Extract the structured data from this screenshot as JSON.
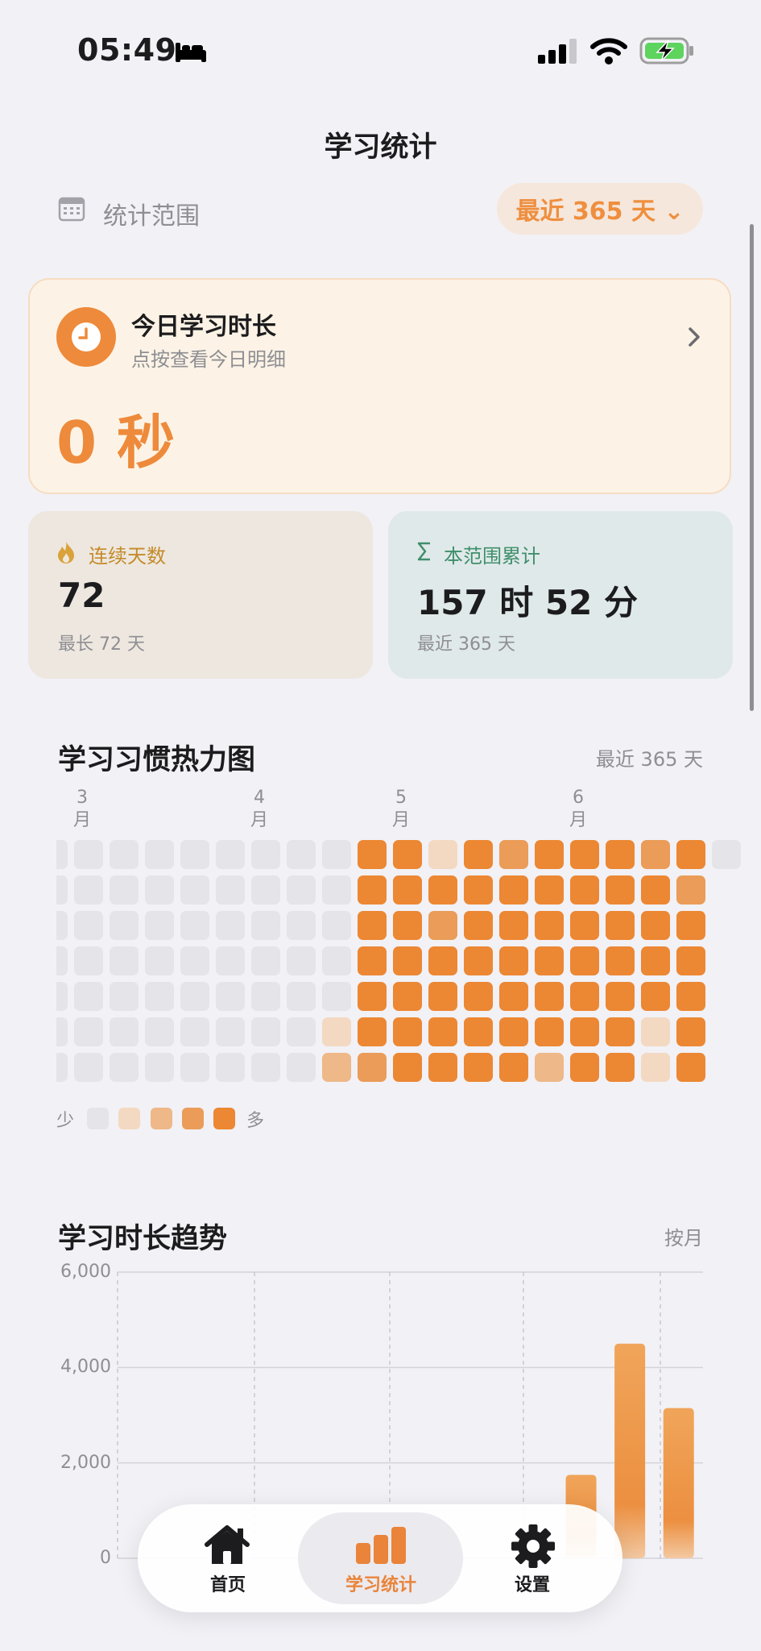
{
  "status_bar": {
    "time": "05:49"
  },
  "nav": {
    "title": "学习统计"
  },
  "range": {
    "label": "统计范围",
    "selected": "最近 365 天 ⌄"
  },
  "today": {
    "title": "今日学习时长",
    "subtitle": "点按查看今日明细",
    "value": "0 秒"
  },
  "streak": {
    "title": "连续天数",
    "value": "72",
    "sub": "最长 72 天"
  },
  "total": {
    "title": "本范围累计",
    "value": "157 时 52 分",
    "sub": "最近 365 天"
  },
  "heatmap": {
    "title": "学习习惯热力图",
    "range_note": "最近 365 天",
    "month_labels": [
      "3\n月",
      "4\n月",
      "5\n月",
      "6\n月"
    ],
    "legend_less": "少",
    "legend_more": "多",
    "levels": [
      "#e5e4e9",
      "#f3d9c1",
      "#eeb888",
      "#ea9c58",
      "#ec8733"
    ],
    "grid": [
      [
        0,
        0,
        0,
        0,
        0,
        0,
        0,
        0,
        4,
        4,
        1,
        4,
        3,
        4,
        4,
        4,
        3,
        4,
        0
      ],
      [
        0,
        0,
        0,
        0,
        0,
        0,
        0,
        0,
        4,
        4,
        4,
        4,
        4,
        4,
        4,
        4,
        4,
        3,
        -1
      ],
      [
        0,
        0,
        0,
        0,
        0,
        0,
        0,
        0,
        4,
        4,
        3,
        4,
        4,
        4,
        4,
        4,
        4,
        4,
        -1
      ],
      [
        0,
        0,
        0,
        0,
        0,
        0,
        0,
        0,
        4,
        4,
        4,
        4,
        4,
        4,
        4,
        4,
        4,
        4,
        -1
      ],
      [
        0,
        0,
        0,
        0,
        0,
        0,
        0,
        0,
        4,
        4,
        4,
        4,
        4,
        4,
        4,
        4,
        4,
        4,
        -1
      ],
      [
        0,
        0,
        0,
        0,
        0,
        0,
        0,
        1,
        4,
        4,
        4,
        4,
        4,
        4,
        4,
        4,
        1,
        4,
        -1
      ],
      [
        0,
        0,
        0,
        0,
        0,
        0,
        0,
        2,
        3,
        4,
        4,
        4,
        4,
        2,
        4,
        4,
        1,
        4,
        -1
      ]
    ]
  },
  "trend": {
    "title": "学习时长趋势",
    "mode": "按月"
  },
  "chart_data": {
    "type": "bar",
    "title": "学习时长趋势",
    "xlabel": "",
    "ylabel": "",
    "ylim": [
      0,
      6000
    ],
    "y_ticks": [
      "6,000",
      "4,000",
      "2,000",
      "0"
    ],
    "categories": [
      "",
      "",
      "",
      "",
      "",
      "",
      "",
      "",
      "",
      "",
      "",
      ""
    ],
    "values": [
      0,
      0,
      0,
      0,
      0,
      0,
      0,
      0,
      0,
      1750,
      4500,
      3150
    ],
    "grid": true
  },
  "tabs": [
    {
      "label": "首页",
      "icon": "home-icon"
    },
    {
      "label": "学习统计",
      "icon": "bar-chart-icon",
      "selected": true
    },
    {
      "label": "设置",
      "icon": "gear-icon"
    }
  ],
  "colors": {
    "accent": "#ee8a3b",
    "streak_text": "#c48b2a",
    "total_text": "#3f8f6c"
  }
}
